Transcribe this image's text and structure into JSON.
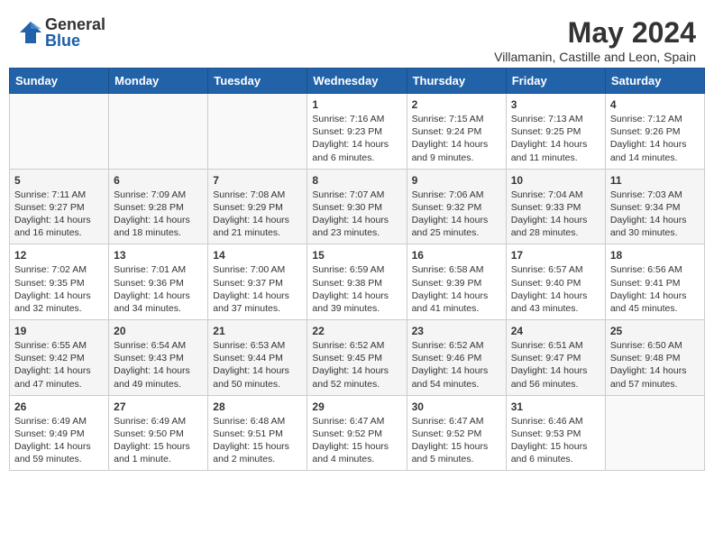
{
  "logo": {
    "general": "General",
    "blue": "Blue"
  },
  "header": {
    "month": "May 2024",
    "location": "Villamanin, Castille and Leon, Spain"
  },
  "weekdays": [
    "Sunday",
    "Monday",
    "Tuesday",
    "Wednesday",
    "Thursday",
    "Friday",
    "Saturday"
  ],
  "weeks": [
    [
      {
        "day": "",
        "content": ""
      },
      {
        "day": "",
        "content": ""
      },
      {
        "day": "",
        "content": ""
      },
      {
        "day": "1",
        "content": "Sunrise: 7:16 AM\nSunset: 9:23 PM\nDaylight: 14 hours\nand 6 minutes."
      },
      {
        "day": "2",
        "content": "Sunrise: 7:15 AM\nSunset: 9:24 PM\nDaylight: 14 hours\nand 9 minutes."
      },
      {
        "day": "3",
        "content": "Sunrise: 7:13 AM\nSunset: 9:25 PM\nDaylight: 14 hours\nand 11 minutes."
      },
      {
        "day": "4",
        "content": "Sunrise: 7:12 AM\nSunset: 9:26 PM\nDaylight: 14 hours\nand 14 minutes."
      }
    ],
    [
      {
        "day": "5",
        "content": "Sunrise: 7:11 AM\nSunset: 9:27 PM\nDaylight: 14 hours\nand 16 minutes."
      },
      {
        "day": "6",
        "content": "Sunrise: 7:09 AM\nSunset: 9:28 PM\nDaylight: 14 hours\nand 18 minutes."
      },
      {
        "day": "7",
        "content": "Sunrise: 7:08 AM\nSunset: 9:29 PM\nDaylight: 14 hours\nand 21 minutes."
      },
      {
        "day": "8",
        "content": "Sunrise: 7:07 AM\nSunset: 9:30 PM\nDaylight: 14 hours\nand 23 minutes."
      },
      {
        "day": "9",
        "content": "Sunrise: 7:06 AM\nSunset: 9:32 PM\nDaylight: 14 hours\nand 25 minutes."
      },
      {
        "day": "10",
        "content": "Sunrise: 7:04 AM\nSunset: 9:33 PM\nDaylight: 14 hours\nand 28 minutes."
      },
      {
        "day": "11",
        "content": "Sunrise: 7:03 AM\nSunset: 9:34 PM\nDaylight: 14 hours\nand 30 minutes."
      }
    ],
    [
      {
        "day": "12",
        "content": "Sunrise: 7:02 AM\nSunset: 9:35 PM\nDaylight: 14 hours\nand 32 minutes."
      },
      {
        "day": "13",
        "content": "Sunrise: 7:01 AM\nSunset: 9:36 PM\nDaylight: 14 hours\nand 34 minutes."
      },
      {
        "day": "14",
        "content": "Sunrise: 7:00 AM\nSunset: 9:37 PM\nDaylight: 14 hours\nand 37 minutes."
      },
      {
        "day": "15",
        "content": "Sunrise: 6:59 AM\nSunset: 9:38 PM\nDaylight: 14 hours\nand 39 minutes."
      },
      {
        "day": "16",
        "content": "Sunrise: 6:58 AM\nSunset: 9:39 PM\nDaylight: 14 hours\nand 41 minutes."
      },
      {
        "day": "17",
        "content": "Sunrise: 6:57 AM\nSunset: 9:40 PM\nDaylight: 14 hours\nand 43 minutes."
      },
      {
        "day": "18",
        "content": "Sunrise: 6:56 AM\nSunset: 9:41 PM\nDaylight: 14 hours\nand 45 minutes."
      }
    ],
    [
      {
        "day": "19",
        "content": "Sunrise: 6:55 AM\nSunset: 9:42 PM\nDaylight: 14 hours\nand 47 minutes."
      },
      {
        "day": "20",
        "content": "Sunrise: 6:54 AM\nSunset: 9:43 PM\nDaylight: 14 hours\nand 49 minutes."
      },
      {
        "day": "21",
        "content": "Sunrise: 6:53 AM\nSunset: 9:44 PM\nDaylight: 14 hours\nand 50 minutes."
      },
      {
        "day": "22",
        "content": "Sunrise: 6:52 AM\nSunset: 9:45 PM\nDaylight: 14 hours\nand 52 minutes."
      },
      {
        "day": "23",
        "content": "Sunrise: 6:52 AM\nSunset: 9:46 PM\nDaylight: 14 hours\nand 54 minutes."
      },
      {
        "day": "24",
        "content": "Sunrise: 6:51 AM\nSunset: 9:47 PM\nDaylight: 14 hours\nand 56 minutes."
      },
      {
        "day": "25",
        "content": "Sunrise: 6:50 AM\nSunset: 9:48 PM\nDaylight: 14 hours\nand 57 minutes."
      }
    ],
    [
      {
        "day": "26",
        "content": "Sunrise: 6:49 AM\nSunset: 9:49 PM\nDaylight: 14 hours\nand 59 minutes."
      },
      {
        "day": "27",
        "content": "Sunrise: 6:49 AM\nSunset: 9:50 PM\nDaylight: 15 hours\nand 1 minute."
      },
      {
        "day": "28",
        "content": "Sunrise: 6:48 AM\nSunset: 9:51 PM\nDaylight: 15 hours\nand 2 minutes."
      },
      {
        "day": "29",
        "content": "Sunrise: 6:47 AM\nSunset: 9:52 PM\nDaylight: 15 hours\nand 4 minutes."
      },
      {
        "day": "30",
        "content": "Sunrise: 6:47 AM\nSunset: 9:52 PM\nDaylight: 15 hours\nand 5 minutes."
      },
      {
        "day": "31",
        "content": "Sunrise: 6:46 AM\nSunset: 9:53 PM\nDaylight: 15 hours\nand 6 minutes."
      },
      {
        "day": "",
        "content": ""
      }
    ]
  ]
}
